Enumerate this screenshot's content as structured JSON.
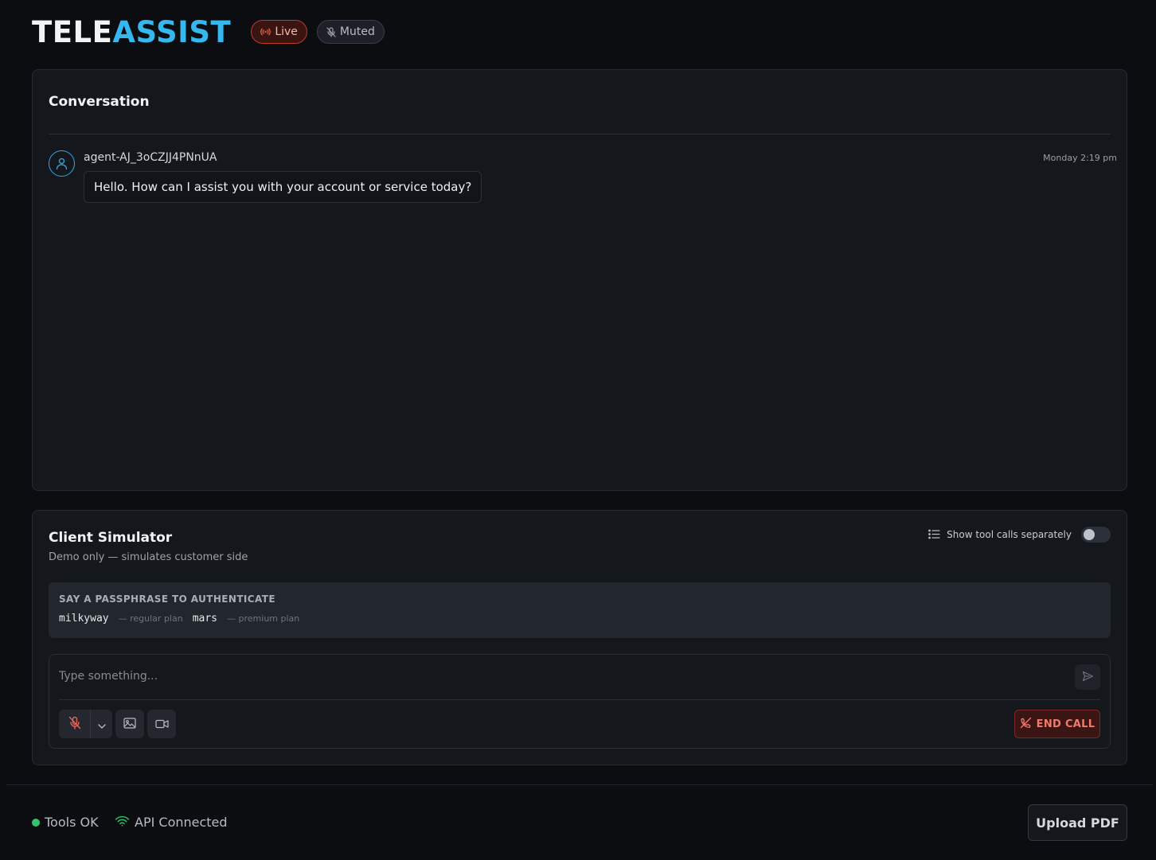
{
  "app": {
    "logo_part1": "TELE",
    "logo_part2": "ASSIST",
    "live_label": "Live",
    "muted_label": "Muted"
  },
  "conversation": {
    "title": "Conversation",
    "messages": [
      {
        "sender": "agent-AJ_3oCZJJ4PNnUA",
        "time": "Monday 2:19 pm",
        "text": "Hello. How can I assist you with your account or service today?"
      }
    ]
  },
  "simulator": {
    "title": "Client Simulator",
    "subtitle": "Demo only — simulates customer side",
    "toggle_label": "Show tool calls separately",
    "toggle_on": false,
    "passphrase": {
      "heading": "SAY A PASSPHRASE TO AUTHENTICATE",
      "items": [
        {
          "code": "milkyway",
          "note": "— regular plan"
        },
        {
          "code": "mars",
          "note": "— premium plan"
        }
      ]
    },
    "input_placeholder": "Type something...",
    "input_value": "",
    "end_call_label": "END CALL"
  },
  "footer": {
    "tools_status": "Tools OK",
    "api_status": "API Connected",
    "upload_label": "Upload PDF"
  },
  "colors": {
    "accent": "#35b8f0",
    "live": "#c2392e",
    "end_call": "#f2796b",
    "ok": "#31c46b"
  }
}
